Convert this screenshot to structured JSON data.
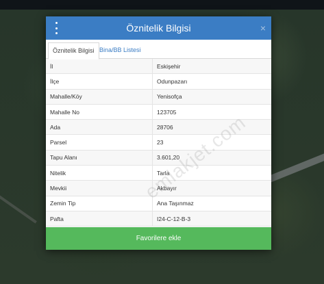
{
  "modal": {
    "title": "Öznitelik Bilgisi",
    "close": "×"
  },
  "tabs": [
    {
      "label": "Öznitelik Bilgisi"
    },
    {
      "label": "Bina/BB Listesi"
    }
  ],
  "attributes": [
    {
      "key": "İl",
      "value": "Eskişehir"
    },
    {
      "key": "İlçe",
      "value": "Odunpazarı"
    },
    {
      "key": "Mahalle/Köy",
      "value": "Yenisofça"
    },
    {
      "key": "Mahalle No",
      "value": "123705"
    },
    {
      "key": "Ada",
      "value": "28706"
    },
    {
      "key": "Parsel",
      "value": "23"
    },
    {
      "key": "Tapu Alanı",
      "value": "3.601,20"
    },
    {
      "key": "Nitelik",
      "value": "Tarla"
    },
    {
      "key": "Mevkii",
      "value": "Akbayır"
    },
    {
      "key": "Zemin Tip",
      "value": "Ana Taşınmaz"
    },
    {
      "key": "Pafta",
      "value": "I24-C-12-B-3"
    }
  ],
  "footer": {
    "favorite_label": "Favorilere ekle"
  },
  "watermark": "emlakjet.com",
  "colors": {
    "header": "#3b7dc4",
    "favorite": "#55b95c"
  }
}
